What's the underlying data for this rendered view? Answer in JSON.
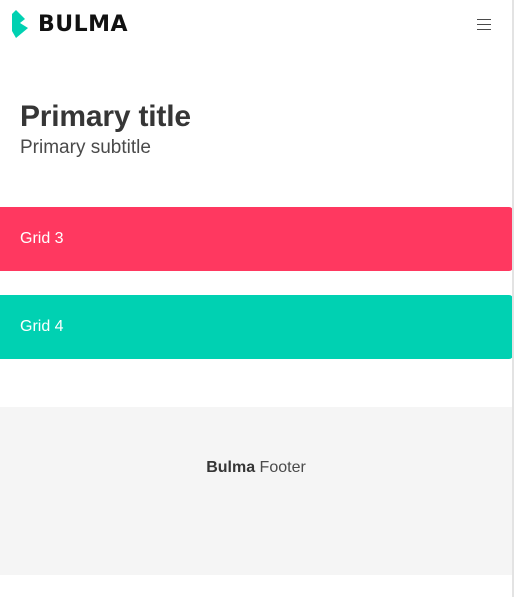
{
  "navbar": {
    "brand_text": "BULMA",
    "brand_icon": "bulma-logo-icon",
    "menu_icon": "hamburger-menu-icon"
  },
  "hero": {
    "title": "Primary title",
    "subtitle": "Primary subtitle"
  },
  "grid": {
    "items": [
      {
        "label": "Grid 3",
        "color": "#ff3860"
      },
      {
        "label": "Grid 4",
        "color": "#00d1b2"
      }
    ]
  },
  "footer": {
    "brand": "Bulma",
    "text": "Footer",
    "background": "#f5f5f5"
  },
  "colors": {
    "brand_teal": "#00d1b2",
    "danger": "#ff3860",
    "text_dark": "#363636"
  }
}
